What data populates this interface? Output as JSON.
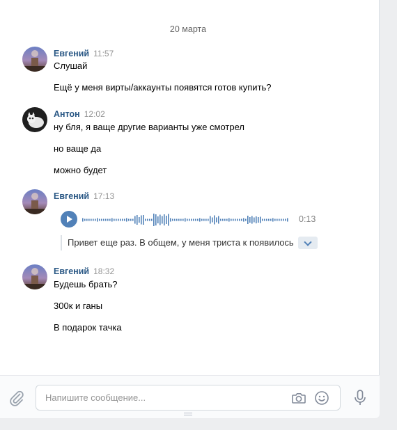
{
  "date_separator": "20 марта",
  "groups": [
    {
      "author": "Евгений",
      "time": "11:57",
      "messages": [
        "Слушай",
        "Ещё у меня вирты/аккаунты появятся готов купить?"
      ]
    },
    {
      "author": "Антон",
      "time": "12:02",
      "messages": [
        "ну бля, я ваще другие варианты уже смотрел",
        "но ваще да",
        "можно будет"
      ]
    },
    {
      "author": "Евгений",
      "time": "17:13",
      "voice": {
        "duration": "0:13",
        "transcript": "Привет еще раз. В общем, у меня триста к появилось"
      }
    },
    {
      "author": "Евгений",
      "time": "18:32",
      "messages": [
        "Будешь брать?",
        "300к и ганы",
        "В подарок тачка"
      ]
    }
  ],
  "composer": {
    "placeholder": "Напишите сообщение...",
    "icons": [
      "paperclip-icon",
      "camera-icon",
      "smile-icon",
      "microphone-icon"
    ]
  },
  "colors": {
    "author": "#2a5885",
    "accent": "#5181b8",
    "muted": "#939393"
  }
}
